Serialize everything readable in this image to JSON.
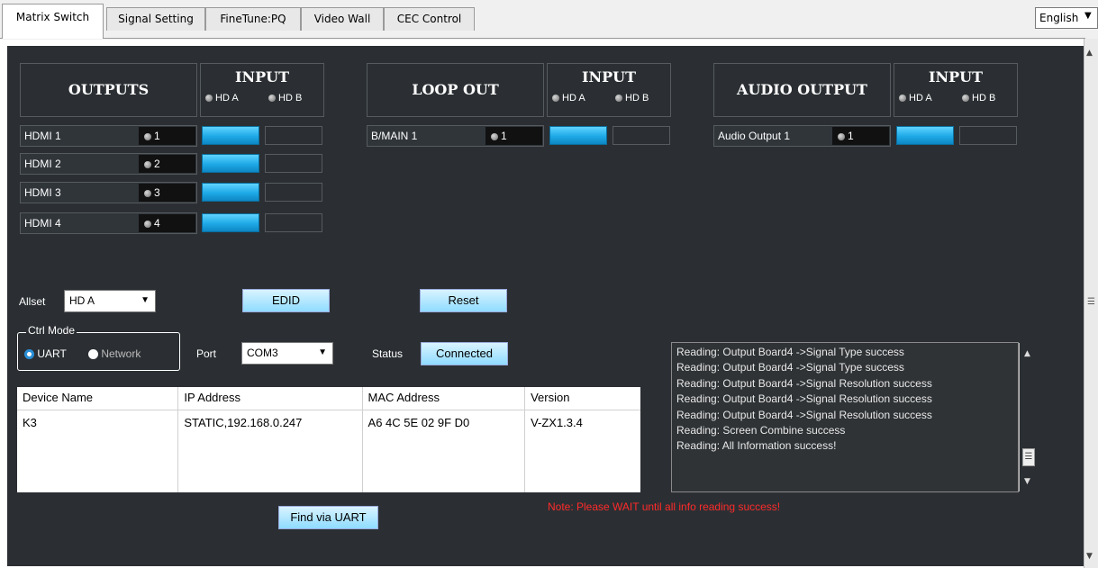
{
  "tabs": [
    "Matrix Switch",
    "Signal Setting",
    "FineTune:PQ",
    "Video Wall",
    "CEC Control"
  ],
  "language": {
    "value": "English"
  },
  "outputs_section": {
    "title": "OUTPUTS",
    "input_title": "INPUT",
    "sources": [
      "HD A",
      "HD B"
    ],
    "rows": [
      {
        "label": "HDMI 1",
        "num": "1",
        "selected": "HD A"
      },
      {
        "label": "HDMI 2",
        "num": "2",
        "selected": "HD A"
      },
      {
        "label": "HDMI 3",
        "num": "3",
        "selected": "HD A"
      },
      {
        "label": "HDMI 4",
        "num": "4",
        "selected": "HD A"
      }
    ]
  },
  "loop_section": {
    "title": "LOOP OUT",
    "input_title": "INPUT",
    "sources": [
      "HD A",
      "HD B"
    ],
    "rows": [
      {
        "label": "B/MAIN 1",
        "num": "1",
        "selected": "HD A"
      }
    ]
  },
  "audio_section": {
    "title": "AUDIO OUTPUT",
    "input_title": "INPUT",
    "sources": [
      "HD A",
      "HD B"
    ],
    "rows": [
      {
        "label": "Audio Output 1",
        "num": "1",
        "selected": "HD A"
      }
    ]
  },
  "controls": {
    "allset_label": "Allset",
    "allset_value": "HD A",
    "edid_label": "EDID",
    "reset_label": "Reset",
    "ctrl_mode_label": "Ctrl Mode",
    "uart_label": "UART",
    "network_label": "Network",
    "ctrl_mode_selected": "UART",
    "port_label": "Port",
    "port_value": "COM3",
    "status_label": "Status",
    "status_value": "Connected",
    "find_label": "Find via UART"
  },
  "device_table": {
    "headers": [
      "Device Name",
      "IP Address",
      "MAC Address",
      "Version"
    ],
    "rows": [
      [
        "K3",
        "STATIC,192.168.0.247",
        "A6 4C 5E 02 9F D0",
        "V-ZX1.3.4"
      ]
    ]
  },
  "log": [
    "Reading: Output Board4 ->Signal Type success",
    "Reading: Output Board4 ->Signal Type success",
    "Reading: Output Board4 ->Signal Resolution success",
    "Reading: Output Board4 ->Signal Resolution success",
    "Reading: Output Board4 ->Signal Resolution success",
    "Reading: Screen Combine success",
    "Reading: All Information success!"
  ],
  "note": "Note: Please WAIT until all info reading success!",
  "colors": {
    "panel_bg": "#2b2f33",
    "selected_cell": "#1ea9e6",
    "note_text": "#ff2a2a"
  }
}
